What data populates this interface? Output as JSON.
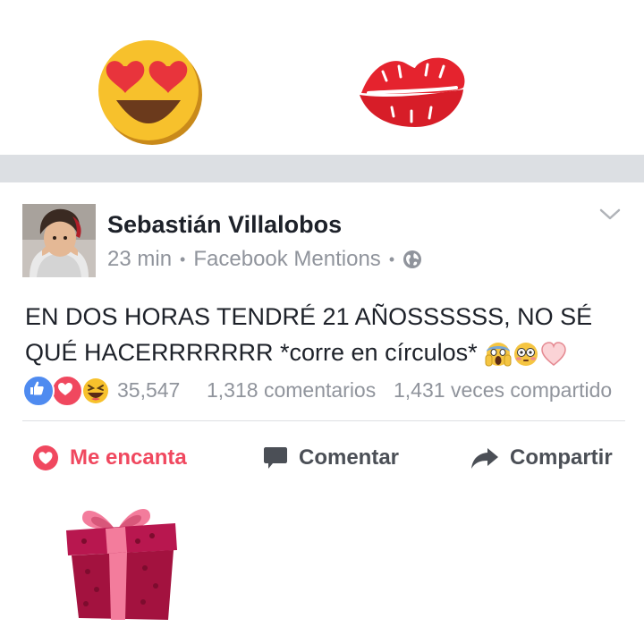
{
  "post": {
    "author": "Sebastián Villalobos",
    "time": "23 min",
    "separator": "•",
    "source": "Facebook Mentions",
    "privacy_icon": "globe-icon",
    "menu_icon": "chevron-down-icon",
    "text": "EN DOS HORAS TENDRÉ 21 AÑOSSSSSS, NO SÉ QUÉ HACERRRRRRR *corre en círculos*",
    "text_emojis": [
      "screaming-face-emoji",
      "flushed-face-emoji",
      "pink-heart-emoji"
    ]
  },
  "reactions": {
    "icons": [
      "like-icon",
      "love-icon",
      "haha-icon"
    ],
    "count": "35,547",
    "comments": "1,318 comentarios",
    "shares": "1,431 veces compartido"
  },
  "actions": {
    "love_label": "Me encanta",
    "comment_label": "Comentar",
    "share_label": "Compartir"
  },
  "stickers": [
    "heart-eyes-emoji",
    "kiss-lips-emoji",
    "gift-box-emoji"
  ],
  "colors": {
    "love_red": "#f0485f",
    "like_blue": "#4f8bf0",
    "meta_gray": "#90949c",
    "band_gray": "#dcdfe3"
  }
}
